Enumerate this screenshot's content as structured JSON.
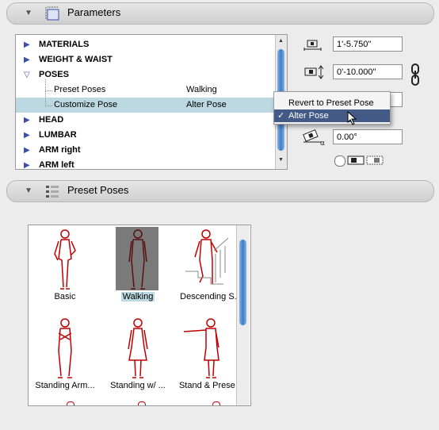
{
  "parameters_panel": {
    "title": "Parameters"
  },
  "tree": {
    "rows": [
      {
        "label": "MATERIALS",
        "expanded": false
      },
      {
        "label": "WEIGHT & WAIST",
        "expanded": false
      },
      {
        "label": "POSES",
        "expanded": true
      },
      {
        "label": "Preset Poses",
        "value": "Walking"
      },
      {
        "label": "Customize Pose",
        "value": "Alter Pose",
        "selected": true
      },
      {
        "label": "HEAD",
        "expanded": false
      },
      {
        "label": "LUMBAR",
        "expanded": false
      },
      {
        "label": "ARM right",
        "expanded": false
      },
      {
        "label": "ARM left",
        "expanded": false
      }
    ]
  },
  "fields": {
    "width": "1'-5.750\"",
    "height": "0'-10.000\"",
    "angle": "0.00°"
  },
  "context_menu": {
    "items": [
      {
        "label": "Revert to Preset Pose",
        "checked": false
      },
      {
        "label": "Alter Pose",
        "checked": true,
        "check_mark": "✓"
      }
    ]
  },
  "preset_panel": {
    "title": "Preset Poses"
  },
  "gallery": {
    "items": [
      {
        "caption": "Basic",
        "pose": "standing-hand-on-hip"
      },
      {
        "caption": "Walking",
        "pose": "walking",
        "selected": true
      },
      {
        "caption": "Descending S...",
        "pose": "descending-stairs"
      },
      {
        "caption": "Standing Arm...",
        "pose": "arms-crossed"
      },
      {
        "caption": "Standing w/ ...",
        "pose": "standing-woman"
      },
      {
        "caption": "Stand & Prese...",
        "pose": "presenting"
      }
    ]
  },
  "colors": {
    "figure": "#c00000",
    "selection": "#bcd8e0",
    "menu_highlight": "#445a86"
  }
}
